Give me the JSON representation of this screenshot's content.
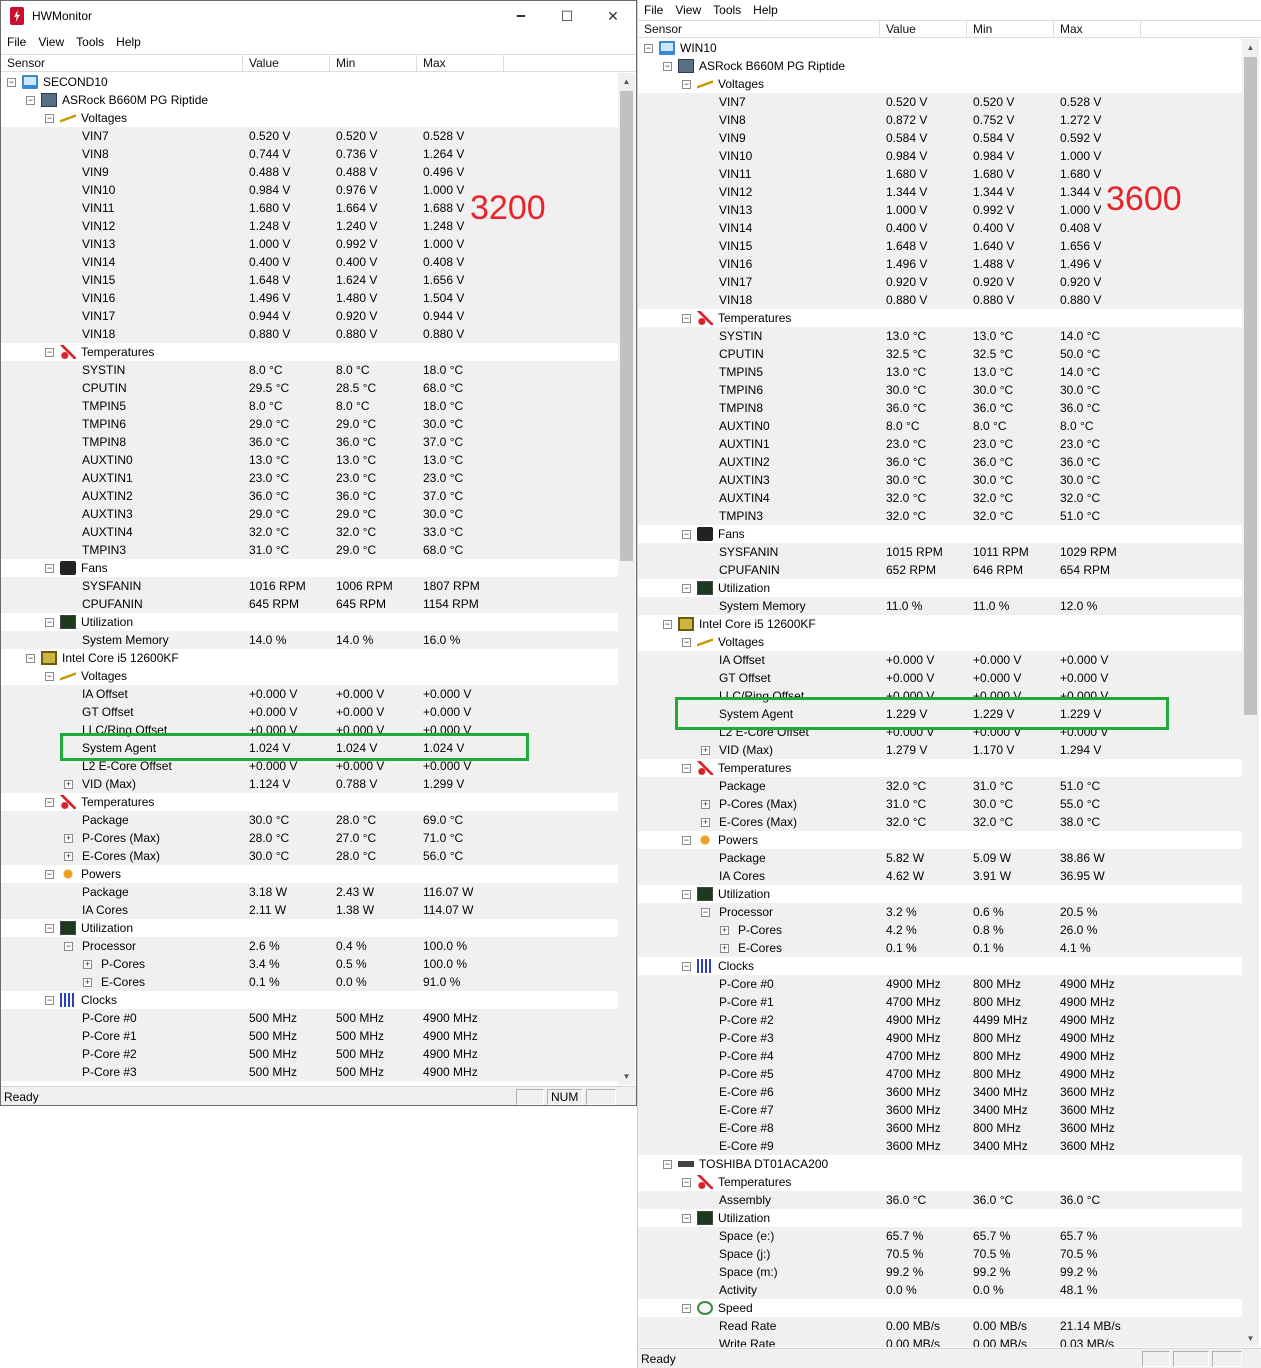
{
  "window_left": {
    "title": "HWMonitor",
    "caption_buttons": [
      "🗕",
      "☐",
      "✕"
    ],
    "menu": [
      "File",
      "View",
      "Tools",
      "Help"
    ],
    "columns": [
      "Sensor",
      "Value",
      "Min",
      "Max"
    ],
    "rows": [
      {
        "d": 0,
        "t": "m",
        "ic": "computer",
        "s": "SECOND10",
        "v": "",
        "n": "",
        "x": ""
      },
      {
        "d": 1,
        "t": "m",
        "ic": "board",
        "s": "ASRock B660M PG Riptide",
        "v": "",
        "n": "",
        "x": ""
      },
      {
        "d": 2,
        "t": "m",
        "ic": "volt",
        "s": "Voltages",
        "v": "",
        "n": "",
        "x": ""
      },
      {
        "d": 3,
        "t": "",
        "s": "VIN7",
        "v": "0.520 V",
        "n": "0.520 V",
        "x": "0.528 V"
      },
      {
        "d": 3,
        "t": "",
        "s": "VIN8",
        "v": "0.744 V",
        "n": "0.736 V",
        "x": "1.264 V"
      },
      {
        "d": 3,
        "t": "",
        "s": "VIN9",
        "v": "0.488 V",
        "n": "0.488 V",
        "x": "0.496 V"
      },
      {
        "d": 3,
        "t": "",
        "s": "VIN10",
        "v": "0.984 V",
        "n": "0.976 V",
        "x": "1.000 V"
      },
      {
        "d": 3,
        "t": "",
        "s": "VIN11",
        "v": "1.680 V",
        "n": "1.664 V",
        "x": "1.688 V"
      },
      {
        "d": 3,
        "t": "",
        "s": "VIN12",
        "v": "1.248 V",
        "n": "1.240 V",
        "x": "1.248 V"
      },
      {
        "d": 3,
        "t": "",
        "s": "VIN13",
        "v": "1.000 V",
        "n": "0.992 V",
        "x": "1.000 V"
      },
      {
        "d": 3,
        "t": "",
        "s": "VIN14",
        "v": "0.400 V",
        "n": "0.400 V",
        "x": "0.408 V"
      },
      {
        "d": 3,
        "t": "",
        "s": "VIN15",
        "v": "1.648 V",
        "n": "1.624 V",
        "x": "1.656 V"
      },
      {
        "d": 3,
        "t": "",
        "s": "VIN16",
        "v": "1.496 V",
        "n": "1.480 V",
        "x": "1.504 V"
      },
      {
        "d": 3,
        "t": "",
        "s": "VIN17",
        "v": "0.944 V",
        "n": "0.920 V",
        "x": "0.944 V"
      },
      {
        "d": 3,
        "t": "",
        "s": "VIN18",
        "v": "0.880 V",
        "n": "0.880 V",
        "x": "0.880 V"
      },
      {
        "d": 2,
        "t": "m",
        "ic": "temp",
        "s": "Temperatures",
        "v": "",
        "n": "",
        "x": ""
      },
      {
        "d": 3,
        "t": "",
        "s": "SYSTIN",
        "v": "8.0 °C",
        "n": "8.0 °C",
        "x": "18.0 °C"
      },
      {
        "d": 3,
        "t": "",
        "s": "CPUTIN",
        "v": "29.5 °C",
        "n": "28.5 °C",
        "x": "68.0 °C"
      },
      {
        "d": 3,
        "t": "",
        "s": "TMPIN5",
        "v": "8.0 °C",
        "n": "8.0 °C",
        "x": "18.0 °C"
      },
      {
        "d": 3,
        "t": "",
        "s": "TMPIN6",
        "v": "29.0 °C",
        "n": "29.0 °C",
        "x": "30.0 °C"
      },
      {
        "d": 3,
        "t": "",
        "s": "TMPIN8",
        "v": "36.0 °C",
        "n": "36.0 °C",
        "x": "37.0 °C"
      },
      {
        "d": 3,
        "t": "",
        "s": "AUXTIN0",
        "v": "13.0 °C",
        "n": "13.0 °C",
        "x": "13.0 °C"
      },
      {
        "d": 3,
        "t": "",
        "s": "AUXTIN1",
        "v": "23.0 °C",
        "n": "23.0 °C",
        "x": "23.0 °C"
      },
      {
        "d": 3,
        "t": "",
        "s": "AUXTIN2",
        "v": "36.0 °C",
        "n": "36.0 °C",
        "x": "37.0 °C"
      },
      {
        "d": 3,
        "t": "",
        "s": "AUXTIN3",
        "v": "29.0 °C",
        "n": "29.0 °C",
        "x": "30.0 °C"
      },
      {
        "d": 3,
        "t": "",
        "s": "AUXTIN4",
        "v": "32.0 °C",
        "n": "32.0 °C",
        "x": "33.0 °C"
      },
      {
        "d": 3,
        "t": "",
        "s": "TMPIN3",
        "v": "31.0 °C",
        "n": "29.0 °C",
        "x": "68.0 °C"
      },
      {
        "d": 2,
        "t": "m",
        "ic": "fan",
        "s": "Fans",
        "v": "",
        "n": "",
        "x": ""
      },
      {
        "d": 3,
        "t": "",
        "s": "SYSFANIN",
        "v": "1016 RPM",
        "n": "1006 RPM",
        "x": "1807 RPM"
      },
      {
        "d": 3,
        "t": "",
        "s": "CPUFANIN",
        "v": "645 RPM",
        "n": "645 RPM",
        "x": "1154 RPM"
      },
      {
        "d": 2,
        "t": "m",
        "ic": "util",
        "s": "Utilization",
        "v": "",
        "n": "",
        "x": ""
      },
      {
        "d": 3,
        "t": "",
        "s": "System Memory",
        "v": "14.0 %",
        "n": "14.0 %",
        "x": "16.0 %"
      },
      {
        "d": 1,
        "t": "m",
        "ic": "cpu",
        "s": "Intel Core i5 12600KF",
        "v": "",
        "n": "",
        "x": ""
      },
      {
        "d": 2,
        "t": "m",
        "ic": "volt",
        "s": "Voltages",
        "v": "",
        "n": "",
        "x": ""
      },
      {
        "d": 3,
        "t": "",
        "s": "IA Offset",
        "v": "+0.000 V",
        "n": "+0.000 V",
        "x": "+0.000 V"
      },
      {
        "d": 3,
        "t": "",
        "s": "GT Offset",
        "v": "+0.000 V",
        "n": "+0.000 V",
        "x": "+0.000 V"
      },
      {
        "d": 3,
        "t": "",
        "s": "LLC/Ring Offset",
        "v": "+0.000 V",
        "n": "+0.000 V",
        "x": "+0.000 V"
      },
      {
        "d": 3,
        "t": "",
        "s": "System Agent",
        "v": "1.024 V",
        "n": "1.024 V",
        "x": "1.024 V"
      },
      {
        "d": 3,
        "t": "",
        "s": "L2 E-Core Offset",
        "v": "+0.000 V",
        "n": "+0.000 V",
        "x": "+0.000 V"
      },
      {
        "d": 3,
        "t": "p",
        "s": "VID (Max)",
        "v": "1.124 V",
        "n": "0.788 V",
        "x": "1.299 V"
      },
      {
        "d": 2,
        "t": "m",
        "ic": "temp",
        "s": "Temperatures",
        "v": "",
        "n": "",
        "x": ""
      },
      {
        "d": 3,
        "t": "",
        "s": "Package",
        "v": "30.0 °C",
        "n": "28.0 °C",
        "x": "69.0 °C"
      },
      {
        "d": 3,
        "t": "p",
        "s": "P-Cores (Max)",
        "v": "28.0 °C",
        "n": "27.0 °C",
        "x": "71.0 °C"
      },
      {
        "d": 3,
        "t": "p",
        "s": "E-Cores (Max)",
        "v": "30.0 °C",
        "n": "28.0 °C",
        "x": "56.0 °C"
      },
      {
        "d": 2,
        "t": "m",
        "ic": "power",
        "s": "Powers",
        "v": "",
        "n": "",
        "x": ""
      },
      {
        "d": 3,
        "t": "",
        "s": "Package",
        "v": "3.18 W",
        "n": "2.43 W",
        "x": "116.07 W"
      },
      {
        "d": 3,
        "t": "",
        "s": "IA Cores",
        "v": "2.11 W",
        "n": "1.38 W",
        "x": "114.07 W"
      },
      {
        "d": 2,
        "t": "m",
        "ic": "util",
        "s": "Utilization",
        "v": "",
        "n": "",
        "x": ""
      },
      {
        "d": 3,
        "t": "m",
        "s": "Processor",
        "v": "2.6 %",
        "n": "0.4 %",
        "x": "100.0 %"
      },
      {
        "d": 4,
        "t": "p",
        "s": "P-Cores",
        "v": "3.4 %",
        "n": "0.5 %",
        "x": "100.0 %"
      },
      {
        "d": 4,
        "t": "p",
        "s": "E-Cores",
        "v": "0.1 %",
        "n": "0.0 %",
        "x": "91.0 %"
      },
      {
        "d": 2,
        "t": "m",
        "ic": "clock",
        "s": "Clocks",
        "v": "",
        "n": "",
        "x": ""
      },
      {
        "d": 3,
        "t": "",
        "s": "P-Core #0",
        "v": "500 MHz",
        "n": "500 MHz",
        "x": "4900 MHz"
      },
      {
        "d": 3,
        "t": "",
        "s": "P-Core #1",
        "v": "500 MHz",
        "n": "500 MHz",
        "x": "4900 MHz"
      },
      {
        "d": 3,
        "t": "",
        "s": "P-Core #2",
        "v": "500 MHz",
        "n": "500 MHz",
        "x": "4900 MHz"
      },
      {
        "d": 3,
        "t": "",
        "s": "P-Core #3",
        "v": "500 MHz",
        "n": "500 MHz",
        "x": "4900 MHz"
      }
    ],
    "status": "Ready",
    "status_panel": "NUM"
  },
  "window_right": {
    "menu": [
      "File",
      "View",
      "Tools",
      "Help"
    ],
    "columns": [
      "Sensor",
      "Value",
      "Min",
      "Max"
    ],
    "rows": [
      {
        "d": 0,
        "t": "m",
        "ic": "computer",
        "s": "WIN10",
        "v": "",
        "n": "",
        "x": ""
      },
      {
        "d": 1,
        "t": "m",
        "ic": "board",
        "s": "ASRock B660M PG Riptide",
        "v": "",
        "n": "",
        "x": ""
      },
      {
        "d": 2,
        "t": "m",
        "ic": "volt",
        "s": "Voltages",
        "v": "",
        "n": "",
        "x": ""
      },
      {
        "d": 3,
        "t": "",
        "s": "VIN7",
        "v": "0.520 V",
        "n": "0.520 V",
        "x": "0.528 V"
      },
      {
        "d": 3,
        "t": "",
        "s": "VIN8",
        "v": "0.872 V",
        "n": "0.752 V",
        "x": "1.272 V"
      },
      {
        "d": 3,
        "t": "",
        "s": "VIN9",
        "v": "0.584 V",
        "n": "0.584 V",
        "x": "0.592 V"
      },
      {
        "d": 3,
        "t": "",
        "s": "VIN10",
        "v": "0.984 V",
        "n": "0.984 V",
        "x": "1.000 V"
      },
      {
        "d": 3,
        "t": "",
        "s": "VIN11",
        "v": "1.680 V",
        "n": "1.680 V",
        "x": "1.680 V"
      },
      {
        "d": 3,
        "t": "",
        "s": "VIN12",
        "v": "1.344 V",
        "n": "1.344 V",
        "x": "1.344 V"
      },
      {
        "d": 3,
        "t": "",
        "s": "VIN13",
        "v": "1.000 V",
        "n": "0.992 V",
        "x": "1.000 V"
      },
      {
        "d": 3,
        "t": "",
        "s": "VIN14",
        "v": "0.400 V",
        "n": "0.400 V",
        "x": "0.408 V"
      },
      {
        "d": 3,
        "t": "",
        "s": "VIN15",
        "v": "1.648 V",
        "n": "1.640 V",
        "x": "1.656 V"
      },
      {
        "d": 3,
        "t": "",
        "s": "VIN16",
        "v": "1.496 V",
        "n": "1.488 V",
        "x": "1.496 V"
      },
      {
        "d": 3,
        "t": "",
        "s": "VIN17",
        "v": "0.920 V",
        "n": "0.920 V",
        "x": "0.920 V"
      },
      {
        "d": 3,
        "t": "",
        "s": "VIN18",
        "v": "0.880 V",
        "n": "0.880 V",
        "x": "0.880 V"
      },
      {
        "d": 2,
        "t": "m",
        "ic": "temp",
        "s": "Temperatures",
        "v": "",
        "n": "",
        "x": ""
      },
      {
        "d": 3,
        "t": "",
        "s": "SYSTIN",
        "v": "13.0 °C",
        "n": "13.0 °C",
        "x": "14.0 °C"
      },
      {
        "d": 3,
        "t": "",
        "s": "CPUTIN",
        "v": "32.5 °C",
        "n": "32.5 °C",
        "x": "50.0 °C"
      },
      {
        "d": 3,
        "t": "",
        "s": "TMPIN5",
        "v": "13.0 °C",
        "n": "13.0 °C",
        "x": "14.0 °C"
      },
      {
        "d": 3,
        "t": "",
        "s": "TMPIN6",
        "v": "30.0 °C",
        "n": "30.0 °C",
        "x": "30.0 °C"
      },
      {
        "d": 3,
        "t": "",
        "s": "TMPIN8",
        "v": "36.0 °C",
        "n": "36.0 °C",
        "x": "36.0 °C"
      },
      {
        "d": 3,
        "t": "",
        "s": "AUXTIN0",
        "v": "8.0 °C",
        "n": "8.0 °C",
        "x": "8.0 °C"
      },
      {
        "d": 3,
        "t": "",
        "s": "AUXTIN1",
        "v": "23.0 °C",
        "n": "23.0 °C",
        "x": "23.0 °C"
      },
      {
        "d": 3,
        "t": "",
        "s": "AUXTIN2",
        "v": "36.0 °C",
        "n": "36.0 °C",
        "x": "36.0 °C"
      },
      {
        "d": 3,
        "t": "",
        "s": "AUXTIN3",
        "v": "30.0 °C",
        "n": "30.0 °C",
        "x": "30.0 °C"
      },
      {
        "d": 3,
        "t": "",
        "s": "AUXTIN4",
        "v": "32.0 °C",
        "n": "32.0 °C",
        "x": "32.0 °C"
      },
      {
        "d": 3,
        "t": "",
        "s": "TMPIN3",
        "v": "32.0 °C",
        "n": "32.0 °C",
        "x": "51.0 °C"
      },
      {
        "d": 2,
        "t": "m",
        "ic": "fan",
        "s": "Fans",
        "v": "",
        "n": "",
        "x": ""
      },
      {
        "d": 3,
        "t": "",
        "s": "SYSFANIN",
        "v": "1015 RPM",
        "n": "1011 RPM",
        "x": "1029 RPM"
      },
      {
        "d": 3,
        "t": "",
        "s": "CPUFANIN",
        "v": "652 RPM",
        "n": "646 RPM",
        "x": "654 RPM"
      },
      {
        "d": 2,
        "t": "m",
        "ic": "util",
        "s": "Utilization",
        "v": "",
        "n": "",
        "x": ""
      },
      {
        "d": 3,
        "t": "",
        "s": "System Memory",
        "v": "11.0 %",
        "n": "11.0 %",
        "x": "12.0 %"
      },
      {
        "d": 1,
        "t": "m",
        "ic": "cpu",
        "s": "Intel Core i5 12600KF",
        "v": "",
        "n": "",
        "x": ""
      },
      {
        "d": 2,
        "t": "m",
        "ic": "volt",
        "s": "Voltages",
        "v": "",
        "n": "",
        "x": ""
      },
      {
        "d": 3,
        "t": "",
        "s": "IA Offset",
        "v": "+0.000 V",
        "n": "+0.000 V",
        "x": "+0.000 V"
      },
      {
        "d": 3,
        "t": "",
        "s": "GT Offset",
        "v": "+0.000 V",
        "n": "+0.000 V",
        "x": "+0.000 V"
      },
      {
        "d": 3,
        "t": "",
        "s": "LLC/Ring Offset",
        "v": "+0.000 V",
        "n": "+0.000 V",
        "x": "+0.000 V"
      },
      {
        "d": 3,
        "t": "",
        "s": "System Agent",
        "v": "1.229 V",
        "n": "1.229 V",
        "x": "1.229 V"
      },
      {
        "d": 3,
        "t": "",
        "s": "L2 E-Core Offset",
        "v": "+0.000 V",
        "n": "+0.000 V",
        "x": "+0.000 V"
      },
      {
        "d": 3,
        "t": "p",
        "s": "VID (Max)",
        "v": "1.279 V",
        "n": "1.170 V",
        "x": "1.294 V"
      },
      {
        "d": 2,
        "t": "m",
        "ic": "temp",
        "s": "Temperatures",
        "v": "",
        "n": "",
        "x": ""
      },
      {
        "d": 3,
        "t": "",
        "s": "Package",
        "v": "32.0 °C",
        "n": "31.0 °C",
        "x": "51.0 °C"
      },
      {
        "d": 3,
        "t": "p",
        "s": "P-Cores (Max)",
        "v": "31.0 °C",
        "n": "30.0 °C",
        "x": "55.0 °C"
      },
      {
        "d": 3,
        "t": "p",
        "s": "E-Cores (Max)",
        "v": "32.0 °C",
        "n": "32.0 °C",
        "x": "38.0 °C"
      },
      {
        "d": 2,
        "t": "m",
        "ic": "power",
        "s": "Powers",
        "v": "",
        "n": "",
        "x": ""
      },
      {
        "d": 3,
        "t": "",
        "s": "Package",
        "v": "5.82 W",
        "n": "5.09 W",
        "x": "38.86 W"
      },
      {
        "d": 3,
        "t": "",
        "s": "IA Cores",
        "v": "4.62 W",
        "n": "3.91 W",
        "x": "36.95 W"
      },
      {
        "d": 2,
        "t": "m",
        "ic": "util",
        "s": "Utilization",
        "v": "",
        "n": "",
        "x": ""
      },
      {
        "d": 3,
        "t": "m",
        "s": "Processor",
        "v": "3.2 %",
        "n": "0.6 %",
        "x": "20.5 %"
      },
      {
        "d": 4,
        "t": "p",
        "s": "P-Cores",
        "v": "4.2 %",
        "n": "0.8 %",
        "x": "26.0 %"
      },
      {
        "d": 4,
        "t": "p",
        "s": "E-Cores",
        "v": "0.1 %",
        "n": "0.1 %",
        "x": "4.1 %"
      },
      {
        "d": 2,
        "t": "m",
        "ic": "clock",
        "s": "Clocks",
        "v": "",
        "n": "",
        "x": ""
      },
      {
        "d": 3,
        "t": "",
        "s": "P-Core #0",
        "v": "4900 MHz",
        "n": "800 MHz",
        "x": "4900 MHz"
      },
      {
        "d": 3,
        "t": "",
        "s": "P-Core #1",
        "v": "4700 MHz",
        "n": "800 MHz",
        "x": "4900 MHz"
      },
      {
        "d": 3,
        "t": "",
        "s": "P-Core #2",
        "v": "4900 MHz",
        "n": "4499 MHz",
        "x": "4900 MHz"
      },
      {
        "d": 3,
        "t": "",
        "s": "P-Core #3",
        "v": "4900 MHz",
        "n": "800 MHz",
        "x": "4900 MHz"
      },
      {
        "d": 3,
        "t": "",
        "s": "P-Core #4",
        "v": "4700 MHz",
        "n": "800 MHz",
        "x": "4900 MHz"
      },
      {
        "d": 3,
        "t": "",
        "s": "P-Core #5",
        "v": "4700 MHz",
        "n": "800 MHz",
        "x": "4900 MHz"
      },
      {
        "d": 3,
        "t": "",
        "s": "E-Core #6",
        "v": "3600 MHz",
        "n": "3400 MHz",
        "x": "3600 MHz"
      },
      {
        "d": 3,
        "t": "",
        "s": "E-Core #7",
        "v": "3600 MHz",
        "n": "3400 MHz",
        "x": "3600 MHz"
      },
      {
        "d": 3,
        "t": "",
        "s": "E-Core #8",
        "v": "3600 MHz",
        "n": "800 MHz",
        "x": "3600 MHz"
      },
      {
        "d": 3,
        "t": "",
        "s": "E-Core #9",
        "v": "3600 MHz",
        "n": "3400 MHz",
        "x": "3600 MHz"
      },
      {
        "d": 1,
        "t": "m",
        "ic": "hdd",
        "s": "TOSHIBA DT01ACA200",
        "v": "",
        "n": "",
        "x": ""
      },
      {
        "d": 2,
        "t": "m",
        "ic": "temp",
        "s": "Temperatures",
        "v": "",
        "n": "",
        "x": ""
      },
      {
        "d": 3,
        "t": "",
        "s": "Assembly",
        "v": "36.0 °C",
        "n": "36.0 °C",
        "x": "36.0 °C"
      },
      {
        "d": 2,
        "t": "m",
        "ic": "util",
        "s": "Utilization",
        "v": "",
        "n": "",
        "x": ""
      },
      {
        "d": 3,
        "t": "",
        "s": "Space (e:)",
        "v": "65.7 %",
        "n": "65.7 %",
        "x": "65.7 %"
      },
      {
        "d": 3,
        "t": "",
        "s": "Space (j:)",
        "v": "70.5 %",
        "n": "70.5 %",
        "x": "70.5 %"
      },
      {
        "d": 3,
        "t": "",
        "s": "Space (m:)",
        "v": "99.2 %",
        "n": "99.2 %",
        "x": "99.2 %"
      },
      {
        "d": 3,
        "t": "",
        "s": "Activity",
        "v": "0.0 %",
        "n": "0.0 %",
        "x": "48.1 %"
      },
      {
        "d": 2,
        "t": "m",
        "ic": "speed",
        "s": "Speed",
        "v": "",
        "n": "",
        "x": ""
      },
      {
        "d": 3,
        "t": "",
        "s": "Read Rate",
        "v": "0.00 MB/s",
        "n": "0.00 MB/s",
        "x": "21.14 MB/s"
      },
      {
        "d": 3,
        "t": "",
        "s": "Write Rate",
        "v": "0.00 MB/s",
        "n": "0.00 MB/s",
        "x": "0.03 MB/s"
      }
    ],
    "status": "Ready"
  },
  "annotations": {
    "label_left": "3200",
    "label_right": "3600",
    "highlight_color": "#1faa3a",
    "label_color": "#e8232a"
  }
}
